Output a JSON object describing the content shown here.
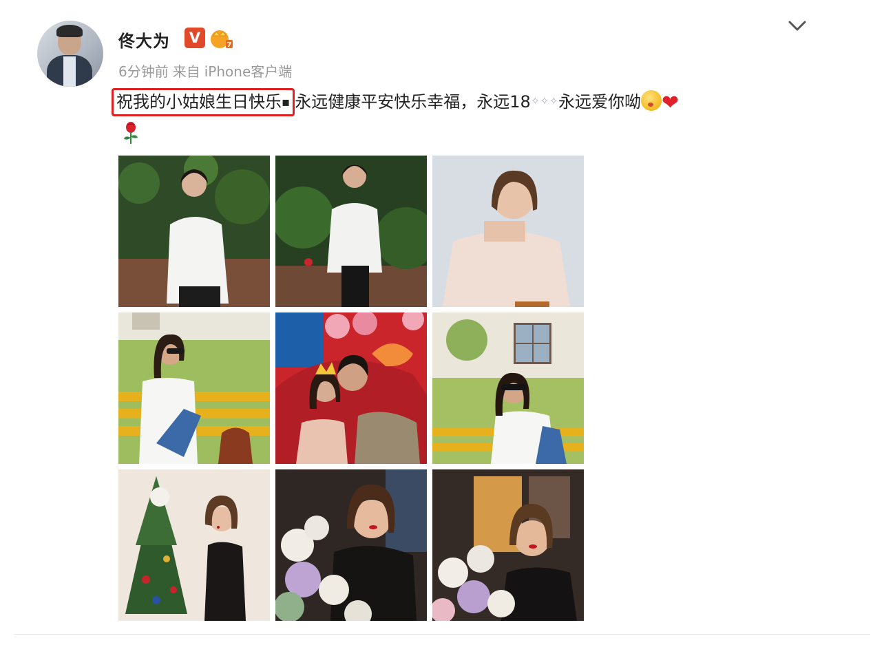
{
  "post": {
    "author": "佟大为",
    "verified_mark": "V",
    "source_time": "6分钟前",
    "source_from": "来自",
    "source_client": "iPhone客户端",
    "text_highlight": "祝我的小姑娘生日快乐",
    "text_part_1": "永远健康平安快乐幸福，永远18",
    "text_part_2": "永远爱你呦"
  },
  "icons": {
    "verified": "verified-v-icon",
    "level": "crown-level-icon",
    "menu": "chevron-down-icon",
    "kiss": "kissing-face-emoji",
    "heart": "red-heart-emoji",
    "rose": "rose-emoji"
  },
  "colors": {
    "verified_badge": "#e0492a",
    "highlight_border": "#e02020",
    "meta_text": "#9a9a9a"
  }
}
